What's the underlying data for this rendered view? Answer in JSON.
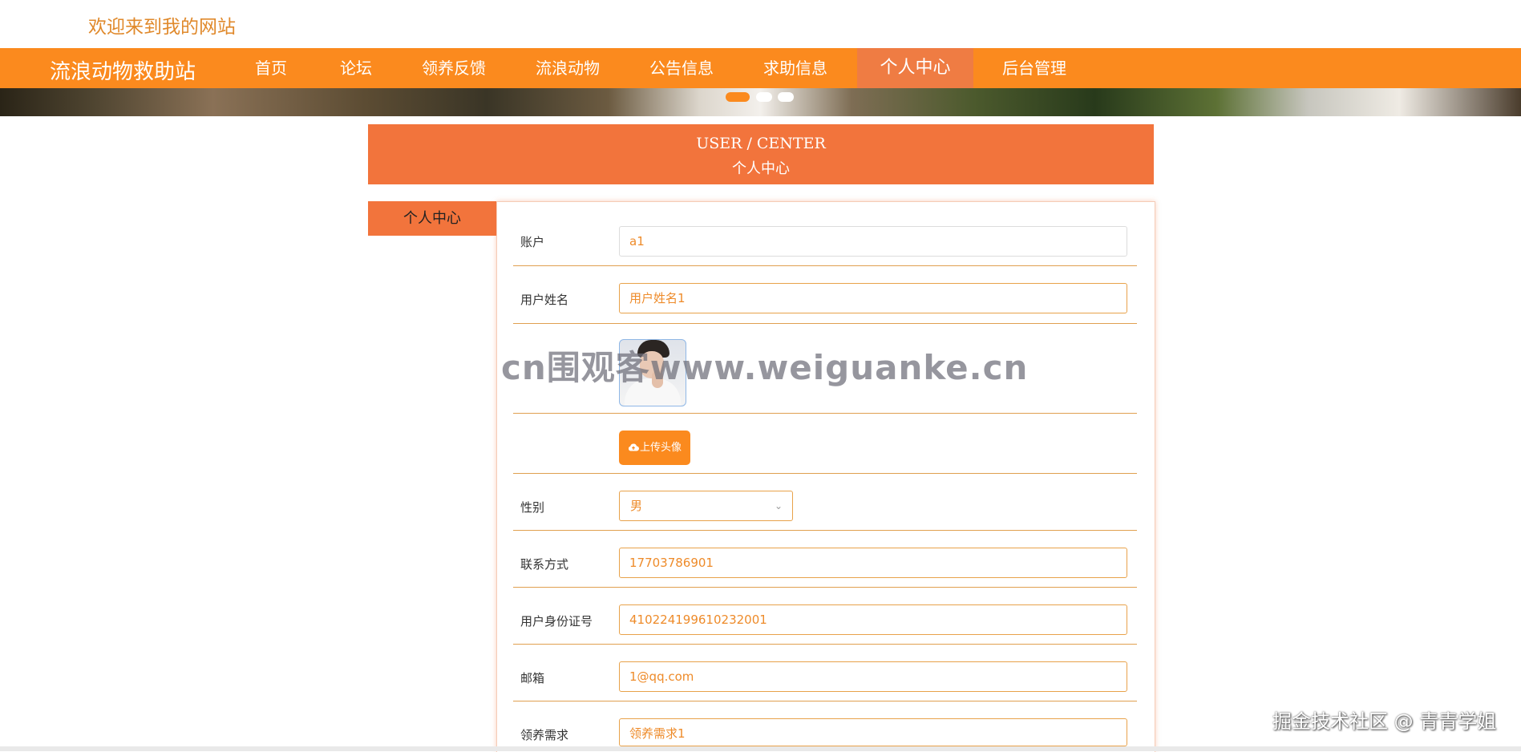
{
  "site": {
    "welcome": "欢迎来到我的网站",
    "brand": "流浪动物救助站"
  },
  "nav": {
    "items": [
      {
        "label": "首页"
      },
      {
        "label": "论坛"
      },
      {
        "label": "领养反馈"
      },
      {
        "label": "流浪动物"
      },
      {
        "label": "公告信息"
      },
      {
        "label": "求助信息"
      },
      {
        "label": "个人中心",
        "active": true
      },
      {
        "label": "后台管理"
      }
    ]
  },
  "carousel": {
    "slide_count": 3,
    "active_index": 0
  },
  "page_header": {
    "title_en": "USER / CENTER",
    "title_cn": "个人中心"
  },
  "sidebar": {
    "tab_label": "个人中心"
  },
  "form": {
    "account": {
      "label": "账户",
      "value": "a1"
    },
    "username": {
      "label": "用户姓名",
      "value": "用户姓名1"
    },
    "upload_button": "上传头像",
    "gender": {
      "label": "性别",
      "value": "男"
    },
    "phone": {
      "label": "联系方式",
      "value": "17703786901"
    },
    "id_number": {
      "label": "用户身份证号",
      "value": "410224199610232001"
    },
    "email": {
      "label": "邮箱",
      "value": "1@qq.com"
    },
    "adoption_need": {
      "label": "领养需求",
      "value": "领养需求1"
    }
  },
  "overlay": {
    "watermark": "cn围观客www.weiguanke.cn",
    "credit": "掘金技术社区 @ 青青学姐"
  },
  "colors": {
    "primary": "#fb8a1e",
    "accent": "#f2743c",
    "field_text": "#ee8b2a"
  }
}
